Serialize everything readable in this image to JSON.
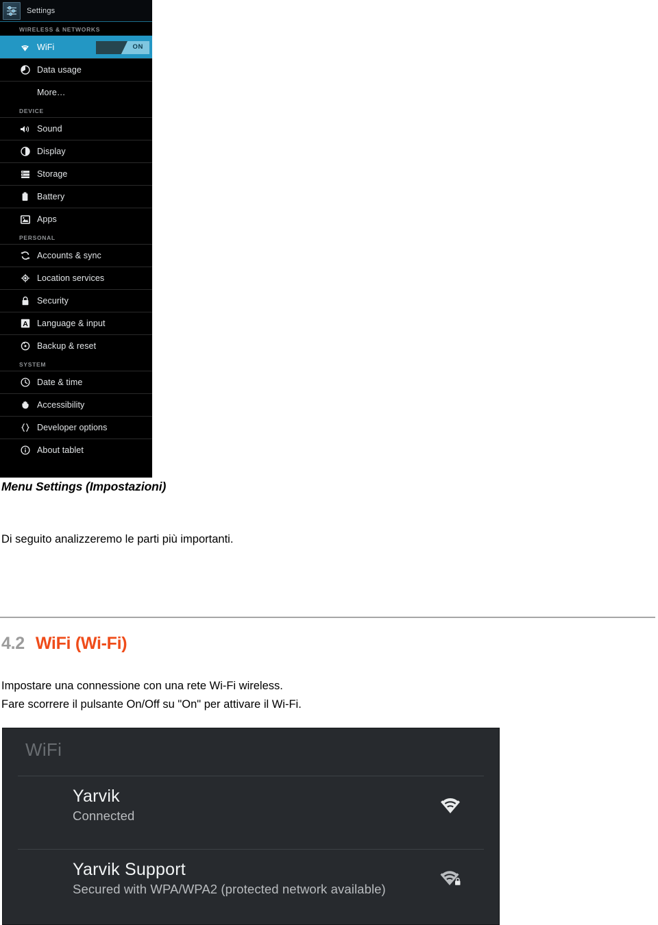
{
  "settings_screenshot": {
    "title": "Settings",
    "app_icon": "sliders-icon",
    "groups": [
      {
        "label": "WIRELESS & NETWORKS",
        "items": [
          {
            "label": "WiFi",
            "icon": "wifi-icon",
            "selected": true,
            "toggle": {
              "state": "ON",
              "label": "ON"
            }
          },
          {
            "label": "Data usage",
            "icon": "pie-chart-icon",
            "selected": false
          },
          {
            "label": "More…",
            "icon": "none",
            "selected": false
          }
        ]
      },
      {
        "label": "DEVICE",
        "items": [
          {
            "label": "Sound",
            "icon": "speaker-icon",
            "selected": false
          },
          {
            "label": "Display",
            "icon": "brightness-icon",
            "selected": false
          },
          {
            "label": "Storage",
            "icon": "storage-icon",
            "selected": false
          },
          {
            "label": "Battery",
            "icon": "battery-icon",
            "selected": false
          },
          {
            "label": "Apps",
            "icon": "apps-image-icon",
            "selected": false
          }
        ]
      },
      {
        "label": "PERSONAL",
        "items": [
          {
            "label": "Accounts & sync",
            "icon": "sync-icon",
            "selected": false
          },
          {
            "label": "Location services",
            "icon": "location-icon",
            "selected": false
          },
          {
            "label": "Security",
            "icon": "lock-icon",
            "selected": false
          },
          {
            "label": "Language & input",
            "icon": "language-a-icon",
            "selected": false
          },
          {
            "label": "Backup & reset",
            "icon": "backup-restore-icon",
            "selected": false
          }
        ]
      },
      {
        "label": "SYSTEM",
        "items": [
          {
            "label": "Date & time",
            "icon": "clock-icon",
            "selected": false
          },
          {
            "label": "Accessibility",
            "icon": "hand-icon",
            "selected": false
          },
          {
            "label": "Developer options",
            "icon": "braces-icon",
            "selected": false
          },
          {
            "label": "About tablet",
            "icon": "info-icon",
            "selected": false
          }
        ]
      }
    ]
  },
  "document": {
    "figure_caption": "Menu Settings (Impostazioni)",
    "intro_paragraph": "Di seguito analizzeremo le parti più importanti.",
    "section": {
      "number": "4.2",
      "title": "WiFi (Wi-Fi)",
      "number_color": "#9b9b9b",
      "title_color": "#ef4c1a"
    },
    "body_line_1": "Impostare una connessione con una rete Wi-Fi wireless.",
    "body_line_2": "Fare scorrere il pulsante On/Off su \"On\" per attivare il Wi-Fi."
  },
  "wifi_screenshot": {
    "header": "WiFi",
    "networks": [
      {
        "ssid": "Yarvik",
        "status": "Connected",
        "icon": "wifi-signal-icon",
        "secured": false
      },
      {
        "ssid": "Yarvik Support",
        "status": "Secured with WPA/WPA2 (protected network available)",
        "icon": "wifi-signal-lock-icon",
        "secured": true
      }
    ]
  }
}
